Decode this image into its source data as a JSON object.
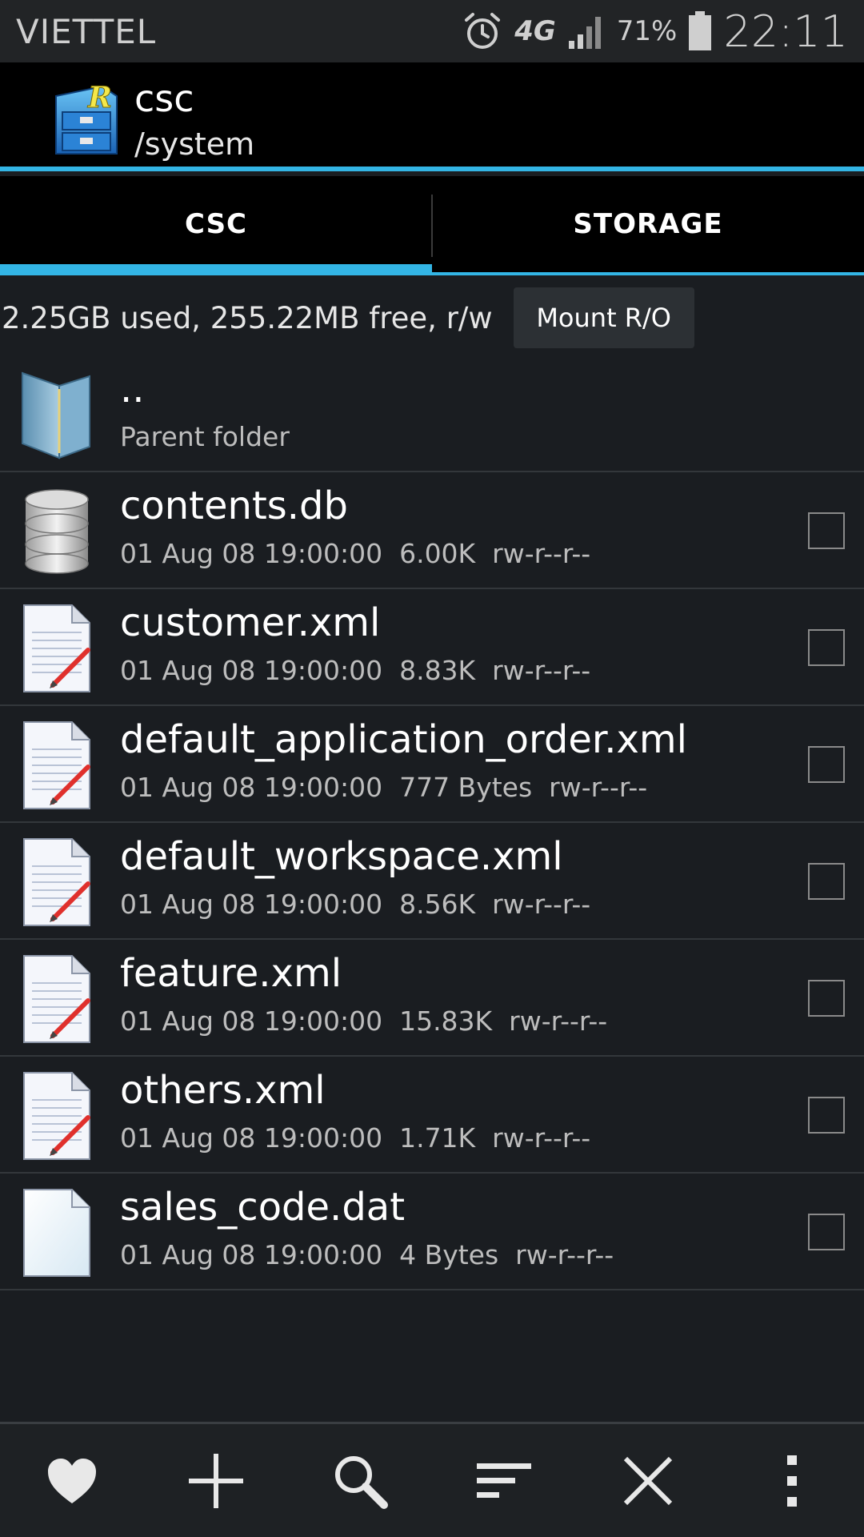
{
  "status_bar": {
    "carrier": "VIETTEL",
    "network_type": "4G",
    "battery_percent": "71%",
    "time": "22:11",
    "icons": [
      "alarm-icon",
      "signal-icon",
      "battery-icon"
    ]
  },
  "header": {
    "title": "csc",
    "path": "/system",
    "logo_icon": "root-explorer-logo-icon"
  },
  "tabs": [
    {
      "label": "CSC",
      "active": true
    },
    {
      "label": "STORAGE",
      "active": false
    }
  ],
  "storage": {
    "info": "2.25GB used, 255.22MB free, r/w",
    "mount_button_label": "Mount R/O"
  },
  "files": [
    {
      "name": "..",
      "meta": "Parent folder",
      "icon": "folder-icon",
      "checkbox": false
    },
    {
      "name": "contents.db",
      "meta": "01 Aug 08 19:00:00  6.00K  rw-r--r--",
      "icon": "database-icon",
      "checkbox": true
    },
    {
      "name": "customer.xml",
      "meta": "01 Aug 08 19:00:00  8.83K  rw-r--r--",
      "icon": "text-file-icon",
      "checkbox": true
    },
    {
      "name": "default_application_order.xml",
      "meta": "01 Aug 08 19:00:00  777 Bytes  rw-r--r--",
      "icon": "text-file-icon",
      "checkbox": true
    },
    {
      "name": "default_workspace.xml",
      "meta": "01 Aug 08 19:00:00  8.56K  rw-r--r--",
      "icon": "text-file-icon",
      "checkbox": true
    },
    {
      "name": "feature.xml",
      "meta": "01 Aug 08 19:00:00  15.83K  rw-r--r--",
      "icon": "text-file-icon",
      "checkbox": true
    },
    {
      "name": "others.xml",
      "meta": "01 Aug 08 19:00:00  1.71K  rw-r--r--",
      "icon": "text-file-icon",
      "checkbox": true
    },
    {
      "name": "sales_code.dat",
      "meta": "01 Aug 08 19:00:00  4 Bytes  rw-r--r--",
      "icon": "blank-file-icon",
      "checkbox": true
    }
  ],
  "toolbar": {
    "icons": [
      "heart-icon",
      "add-icon",
      "search-icon",
      "sort-icon",
      "close-icon",
      "overflow-menu-icon"
    ]
  },
  "colors": {
    "accent": "#33b5e5",
    "background": "#1a1d21",
    "header_background": "#000000"
  }
}
